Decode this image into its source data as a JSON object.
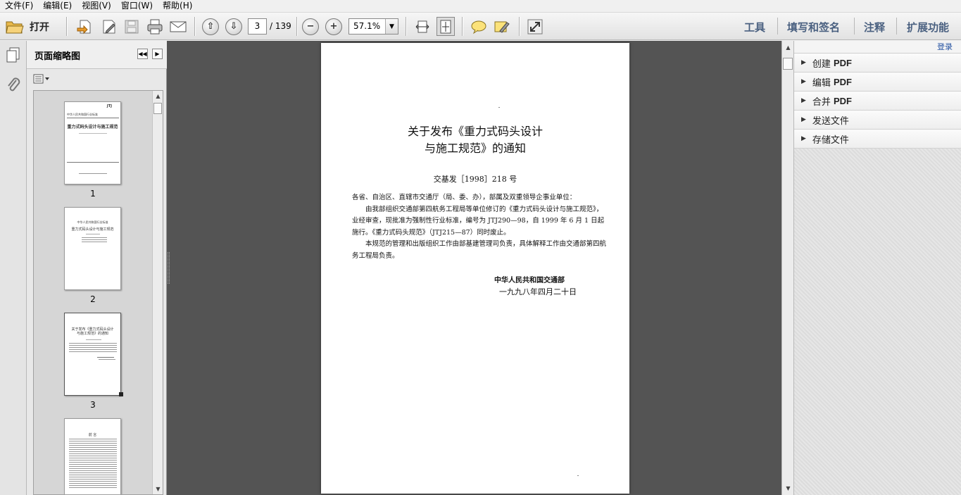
{
  "menu": [
    "文件(F)",
    "编辑(E)",
    "视图(V)",
    "窗口(W)",
    "帮助(H)"
  ],
  "toolbar": {
    "open_label": "打开",
    "current_page": "3",
    "page_total": "/ 139",
    "zoom": "57.1%",
    "right_links": [
      "工具",
      "填写和签名",
      "注释",
      "扩展功能"
    ]
  },
  "thumbnails": {
    "title": "页面缩略图",
    "pages": [
      {
        "num": "1",
        "lines": [
          "JTJ",
          "中华人民共和国行业标准",
          "重力式码头设计与施工规范"
        ]
      },
      {
        "num": "2",
        "lines": [
          "中华人民共和国行业标准",
          "重力式码头设计与施工规范"
        ]
      },
      {
        "num": "3",
        "lines": [
          "关于发布《重力式码头设计",
          "与施工规范》的通知"
        ]
      },
      {
        "num": "4",
        "lines": [
          "前  言"
        ]
      }
    ]
  },
  "document": {
    "title_line1": "关于发布《重力式码头设计",
    "title_line2": "与施工规范》的通知",
    "doc_no": "交基发［1998］218 号",
    "paragraphs": [
      "各省、自治区、直辖市交通厅（局、委、办），部属及双重领导企事业单位：",
      "由我部组织交通部第四航务工程局等单位修订的《重力式码头设计与施工规范》，业经审查，现批准为强制性行业标准，编号为 JTJ290—98，自 1999 年 6 月 1 日起施行。《重力式码头规范》（JTJ215—87）同时废止。",
      "本规范的管理和出版组织工作由部基建管理司负责，具体解释工作由交通部第四航务工程局负责。"
    ],
    "org": "中华人民共和国交通部",
    "date": "一九九八年四月二十日"
  },
  "taskpane": {
    "login": "登录",
    "tasks": [
      {
        "label": "创建",
        "suffix": "PDF"
      },
      {
        "label": "编辑",
        "suffix": "PDF"
      },
      {
        "label": "合并",
        "suffix": "PDF"
      },
      {
        "label": "发送文件",
        "suffix": ""
      },
      {
        "label": "存储文件",
        "suffix": ""
      }
    ]
  }
}
